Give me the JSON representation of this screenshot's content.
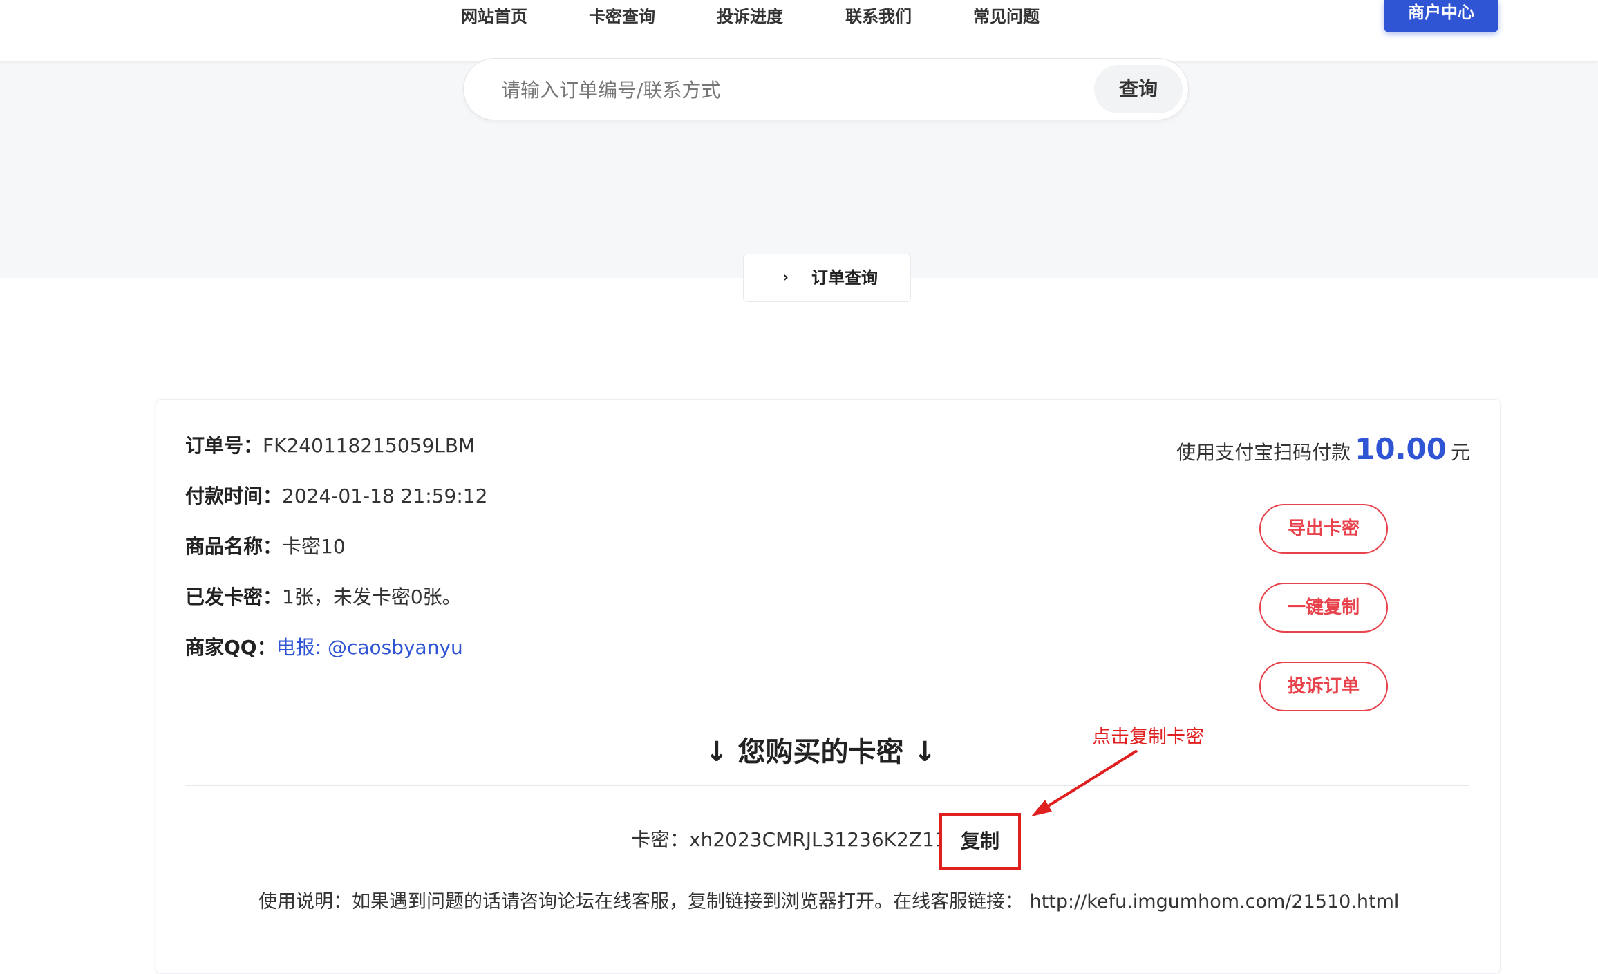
{
  "header": {
    "nav": [
      "网站首页",
      "卡密查询",
      "投诉进度",
      "联系我们",
      "常见问题"
    ],
    "merchant_button": "商户中心"
  },
  "search": {
    "placeholder": "请输入订单编号/联系方式",
    "button": "查询"
  },
  "tab": {
    "chevron": "›",
    "label": "订单查询"
  },
  "order": {
    "order_no_label": "订单号：",
    "order_no": "FK240118215059LBM",
    "pay_time_label": "付款时间：",
    "pay_time": "2024-01-18 21:59:12",
    "product_label": "商品名称：",
    "product": "卡密10",
    "issued_label": "已发卡密：",
    "issued": "1张，未发卡密0张。",
    "qq_label": "商家QQ：",
    "qq": "电报: @caosbyanyu"
  },
  "payment": {
    "prefix": "使用支付宝扫码付款",
    "amount": "10.00",
    "unit": "元"
  },
  "actions": {
    "export": "导出卡密",
    "copy_all": "一键复制",
    "complain": "投诉订单"
  },
  "cards": {
    "title": "↓ 您购买的卡密 ↓",
    "key_label": "卡密：",
    "key": "xh2023CMRJL31236K2Z11",
    "copy": "复制",
    "annotation": "点击复制卡密",
    "usage": "使用说明：如果遇到问题的话请咨询论坛在线客服，复制链接到浏览器打开。在线客服链接： http://kefu.imgumhom.com/21510.html"
  },
  "colors": {
    "accent": "#2f55d4",
    "danger": "#e8434c",
    "annotation": "#e02020"
  },
  "icons": {
    "tab_chevron": "chevron-right-icon",
    "annotation_arrow": "arrow-icon"
  }
}
